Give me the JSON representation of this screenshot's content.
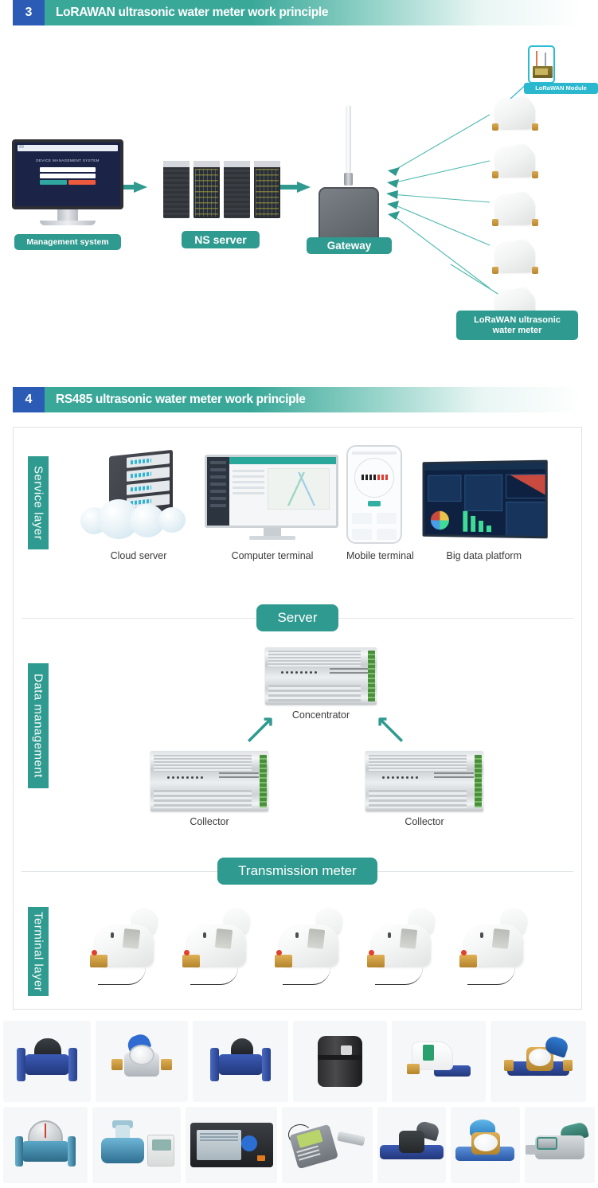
{
  "sections": [
    {
      "number": "3",
      "title": "LoRAWAN ultrasonic water meter work principle"
    },
    {
      "number": "4",
      "title": "RS485 ultrasonic water meter work principle"
    }
  ],
  "lorawan_diagram": {
    "monitor_screen_title": "DEVICE MANAGEMENT SYSTEM",
    "labels": {
      "management_system": "Management system",
      "ns_server": "NS server",
      "gateway": "Gateway",
      "lorawan_module": "LoRaWAN  Module",
      "lorawan_water_meter": "LoRaWAN ultrasonic\nwater meter"
    },
    "meter_count": 5,
    "rack_count": 4
  },
  "rs485_diagram": {
    "service_layer": {
      "side_label": "Service layer",
      "items": [
        {
          "caption": "Cloud server",
          "icon": "cloud-server-icon"
        },
        {
          "caption": "Computer terminal",
          "icon": "computer-terminal-icon"
        },
        {
          "caption": "Mobile terminal",
          "icon": "mobile-terminal-icon"
        },
        {
          "caption": "Big data platform",
          "icon": "big-data-platform-icon"
        }
      ]
    },
    "server_badge": "Server",
    "data_management": {
      "side_label": "Data management",
      "concentrator_caption": "Concentrator",
      "collector_left_caption": "Collector",
      "collector_right_caption": "Collector"
    },
    "transmission_badge": "Transmission meter",
    "terminal_layer": {
      "side_label": "Terminal layer",
      "meter_count": 5
    }
  },
  "gallery": {
    "row1": [
      {
        "name": "woltman-water-meter"
      },
      {
        "name": "brass-dial-water-meter"
      },
      {
        "name": "flanged-bulk-water-meter"
      },
      {
        "name": "black-plastic-water-meter"
      },
      {
        "name": "white-smart-valve-meter"
      },
      {
        "name": "blue-lid-brass-meter"
      }
    ],
    "row2": [
      {
        "name": "oval-gear-flow-meter"
      },
      {
        "name": "electromagnetic-flow-meter"
      },
      {
        "name": "paperless-recorder"
      },
      {
        "name": "handheld-ultrasonic-flow-meter"
      },
      {
        "name": "black-cap-water-meter"
      },
      {
        "name": "blue-lid-dial-meter"
      },
      {
        "name": "grey-smart-water-meter"
      }
    ]
  },
  "colors": {
    "teal": "#2f9a8f",
    "blue_badge": "#2b5bb5",
    "cyan": "#2bb8cf",
    "arrow": "#2f9a8f"
  }
}
